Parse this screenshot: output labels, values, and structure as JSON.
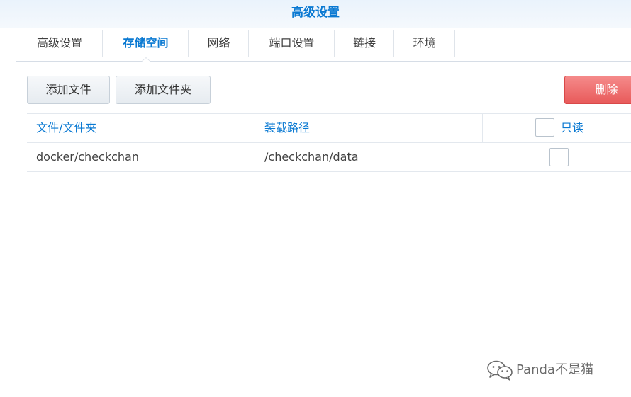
{
  "window": {
    "title": "高级设置"
  },
  "tabs": [
    {
      "label": "高级设置",
      "active": false
    },
    {
      "label": "存储空间",
      "active": true
    },
    {
      "label": "网络",
      "active": false
    },
    {
      "label": "端口设置",
      "active": false
    },
    {
      "label": "链接",
      "active": false
    },
    {
      "label": "环境",
      "active": false
    }
  ],
  "toolbar": {
    "add_file_label": "添加文件",
    "add_folder_label": "添加文件夹",
    "delete_label": "删除"
  },
  "table": {
    "columns": {
      "file_folder": "文件/文件夹",
      "mount_path": "装载路径",
      "readonly": "只读"
    },
    "rows": [
      {
        "file_folder": "docker/checkchan",
        "mount_path": "/checkchan/data",
        "readonly": false
      }
    ]
  },
  "watermark": {
    "text": "Panda不是猫",
    "icon": "wechat-icon"
  },
  "colors": {
    "accent": "#0a79d2",
    "danger": "#e85a5a"
  }
}
